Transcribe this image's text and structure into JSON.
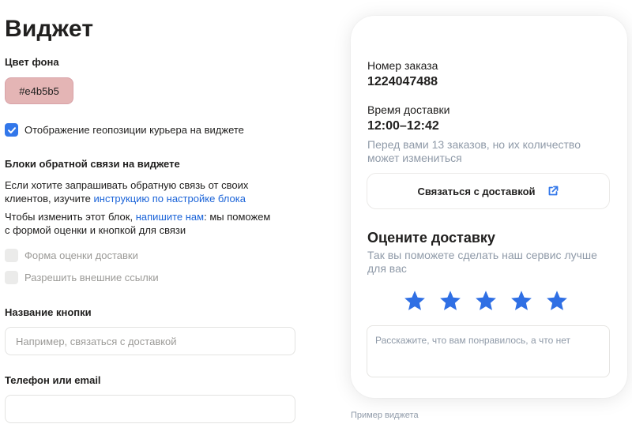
{
  "page_title": "Виджет",
  "settings": {
    "bg_color_label": "Цвет фона",
    "bg_color_value": "#e4b5b5",
    "show_geo_label": "Отображение геопозиции курьера на виджете",
    "show_geo_checked": true,
    "feedback_blocks_title": "Блоки обратной связи на виджете",
    "feedback_para1_text": "Если хотите запрашивать обратную связь от своих клиентов, изучите ",
    "feedback_para1_link": "инструкцию по настройке блока",
    "feedback_para2_text_a": "Чтобы изменить этот блок, ",
    "feedback_para2_link": "напишите нам",
    "feedback_para2_text_b": ": мы поможем с формой оценки и кнопкой для связи",
    "rating_form_label": "Форма оценки доставки",
    "external_links_label": "Разрешить внешние ссылки",
    "button_name_label": "Название кнопки",
    "button_name_placeholder": "Например, связаться с доставкой",
    "button_name_value": "",
    "contact_label": "Телефон или email",
    "contact_placeholder": "",
    "contact_value": ""
  },
  "widget": {
    "order_label": "Номер заказа",
    "order_number": "1224047488",
    "delivery_time_label": "Время доставки",
    "delivery_time": "12:00–12:42",
    "queue_note": "Перед вами 13 заказов, но их количество может измениться",
    "contact_button_label": "Связаться с доставкой",
    "rate_title": "Оцените доставку",
    "rate_subtitle": "Так вы поможете сделать наш сервис лучше для вас",
    "stars_count": 5,
    "feedback_placeholder": "Расскажите, что вам понравилось, а что нет"
  },
  "caption": "Пример виджета",
  "colors": {
    "accent": "#3277ea",
    "link": "#1a63d8",
    "muted": "#8f9aa8",
    "star": "#2f6fe4"
  }
}
